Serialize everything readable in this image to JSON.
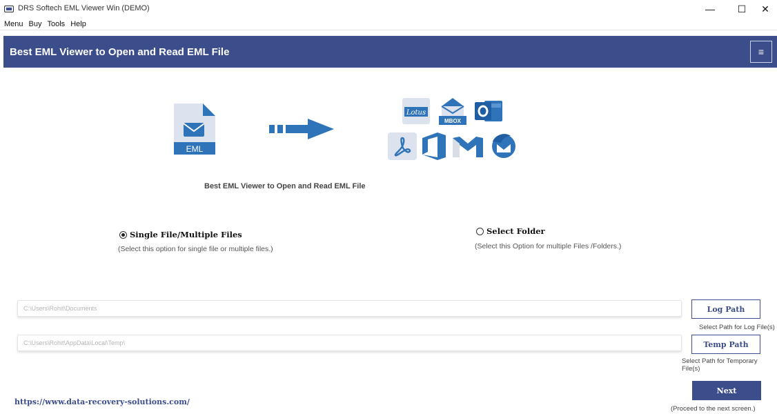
{
  "window": {
    "title": "DRS Softech EML Viewer Win (DEMO)",
    "minimize": "—",
    "maximize": "☐",
    "close": "✕"
  },
  "menu": {
    "items": [
      "Menu",
      "Buy",
      "Tools",
      "Help"
    ]
  },
  "header": {
    "title": "Best EML Viewer to Open and Read EML File",
    "menu_icon": "≡"
  },
  "illustration": {
    "source_label": "EML",
    "caption": "Best EML Viewer to Open and Read EML File",
    "target_labels": {
      "mbox": "MBOX"
    },
    "icons": [
      "eml-file-icon",
      "arrow-right-icon",
      "lotus-icon",
      "mbox-icon",
      "outlook-icon",
      "pdf-icon",
      "office365-icon",
      "gmail-icon",
      "thunderbird-icon"
    ],
    "accent": "#3c4d8c",
    "icon_color": "#2f73b8"
  },
  "options": {
    "single": {
      "label": "Single File/Multiple Files",
      "desc": "(Select this option for single file or multiple files.)",
      "checked": true
    },
    "folder": {
      "label": "Select Folder",
      "desc": "(Select this Option for multiple Files /Folders.)",
      "checked": false
    }
  },
  "paths": {
    "log": {
      "value": "C:\\Users\\Rohit\\Documents",
      "button": "Log Path",
      "hint": "Select Path for Log File(s)"
    },
    "temp": {
      "value": "C:\\Users\\Rohit\\AppData\\Local\\Temp\\",
      "button": "Temp Path",
      "hint": "Select Path for Temporary File(s)"
    }
  },
  "footer": {
    "link": "https://www.data-recovery-solutions.com/",
    "next_label": "Next",
    "next_hint": "(Proceed to the next screen.)"
  },
  "colors": {
    "primary": "#3c4d8c",
    "background": "#ffffff"
  }
}
